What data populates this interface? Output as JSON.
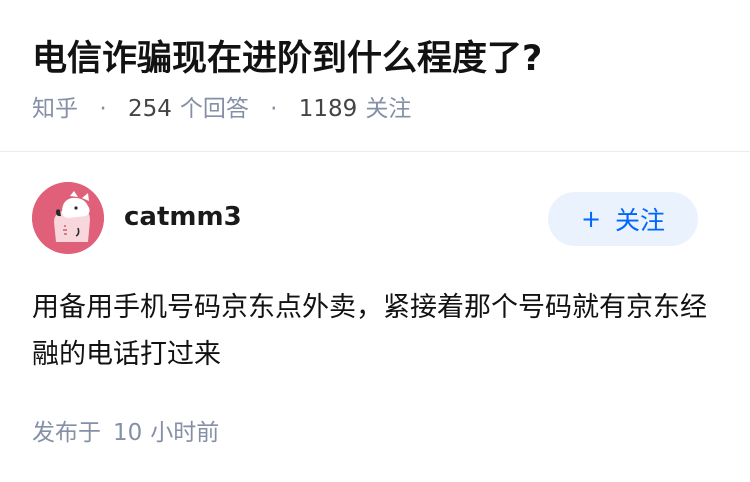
{
  "question": {
    "title": "电信诈骗现在进阶到什么程度了?",
    "source": "知乎",
    "answer_count": "254",
    "answer_count_label": "个回答",
    "follower_count": "1189",
    "follower_count_label": "关注",
    "separator": "·"
  },
  "answer": {
    "author": {
      "name": "catmm3",
      "avatar_icon": "cat-avatar-icon"
    },
    "follow_button": {
      "icon": "plus-icon",
      "plus_glyph": "+",
      "label": "关注"
    },
    "content": "用备用手机号码京东点外卖，紧接着那个号码就有京东经融的电话打过来",
    "publish_label": "发布于",
    "publish_time_number": "10",
    "publish_time_unit": "小时前"
  },
  "colors": {
    "primary": "#0066ff",
    "follow_bg": "#eaf2fd",
    "meta_text": "#8590a6",
    "avatar_bg": "#e0607a"
  }
}
